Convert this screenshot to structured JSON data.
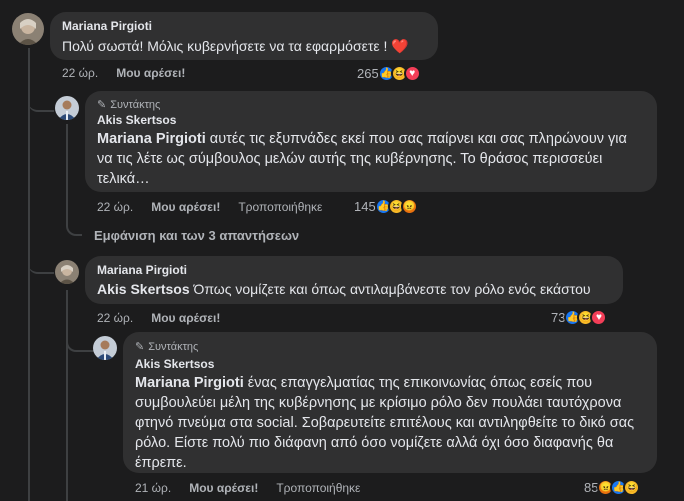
{
  "comments": [
    {
      "author": "Mariana Pirgioti",
      "text": "Πολύ σωστά! Μόλις κυβερνήσετε να τα εφαρμόσετε ! ❤️",
      "time": "22 ώρ.",
      "like": "Μου αρέσει!",
      "reaction_count": "265",
      "reactions": [
        "like",
        "haha",
        "love"
      ]
    },
    {
      "badge": "Συντάκτης",
      "author": "Akis Skertsos",
      "mention": "Mariana Pirgioti",
      "text": " αυτές τις εξυπνάδες εκεί που σας παίρνει και σας πληρώνουν για να τις λέτε ως σύμβουλος μελών αυτής της κυβέρνησης. Το θράσος περισσεύει τελικά…",
      "time": "22 ώρ.",
      "like": "Μου αρέσει!",
      "edited": "Τροποποιήθηκε",
      "reaction_count": "145",
      "reactions": [
        "like",
        "haha",
        "angry"
      ]
    },
    {
      "author": "Mariana Pirgioti",
      "mention": "Akis Skertsos",
      "text": " Όπως νομίζετε και όπως αντιλαμβάνεστε τον ρόλο ενός εκάστου",
      "time": "22 ώρ.",
      "like": "Μου αρέσει!",
      "reaction_count": "73",
      "reactions": [
        "like",
        "haha",
        "love"
      ]
    },
    {
      "badge": "Συντάκτης",
      "author": "Akis Skertsos",
      "mention": "Mariana Pirgioti",
      "text": " ένας επαγγελματίας της επικοινωνίας όπως εσείς που συμβουλεύει μέλη της κυβέρνησης με κρίσιμο ρόλο δεν πουλάει ταυτόχρονα φτηνό πνεύμα στα social. Σοβαρευτείτε επιτέλους και αντιληφθείτε το δικό σας ρόλο. Είστε πολύ πιο διάφανη από όσο νομίζετε αλλά όχι όσο διαφανής θα έπρεπε.",
      "time": "21 ώρ.",
      "like": "Μου αρέσει!",
      "edited": "Τροποποιήθηκε",
      "reaction_count": "85",
      "reactions": [
        "angry",
        "like",
        "haha"
      ]
    }
  ],
  "more_replies": "Εμφάνιση και των 3 απαντήσεων",
  "colors": {
    "background": "#1c1c1d",
    "bubble": "#303031",
    "text": "#e4e6eb",
    "muted": "#b0b3b8"
  },
  "icons": {
    "badge": "pencil-icon",
    "like": "thumbs-up-icon",
    "love": "heart-icon",
    "haha": "laughing-emoji-icon",
    "angry": "angry-emoji-icon"
  }
}
